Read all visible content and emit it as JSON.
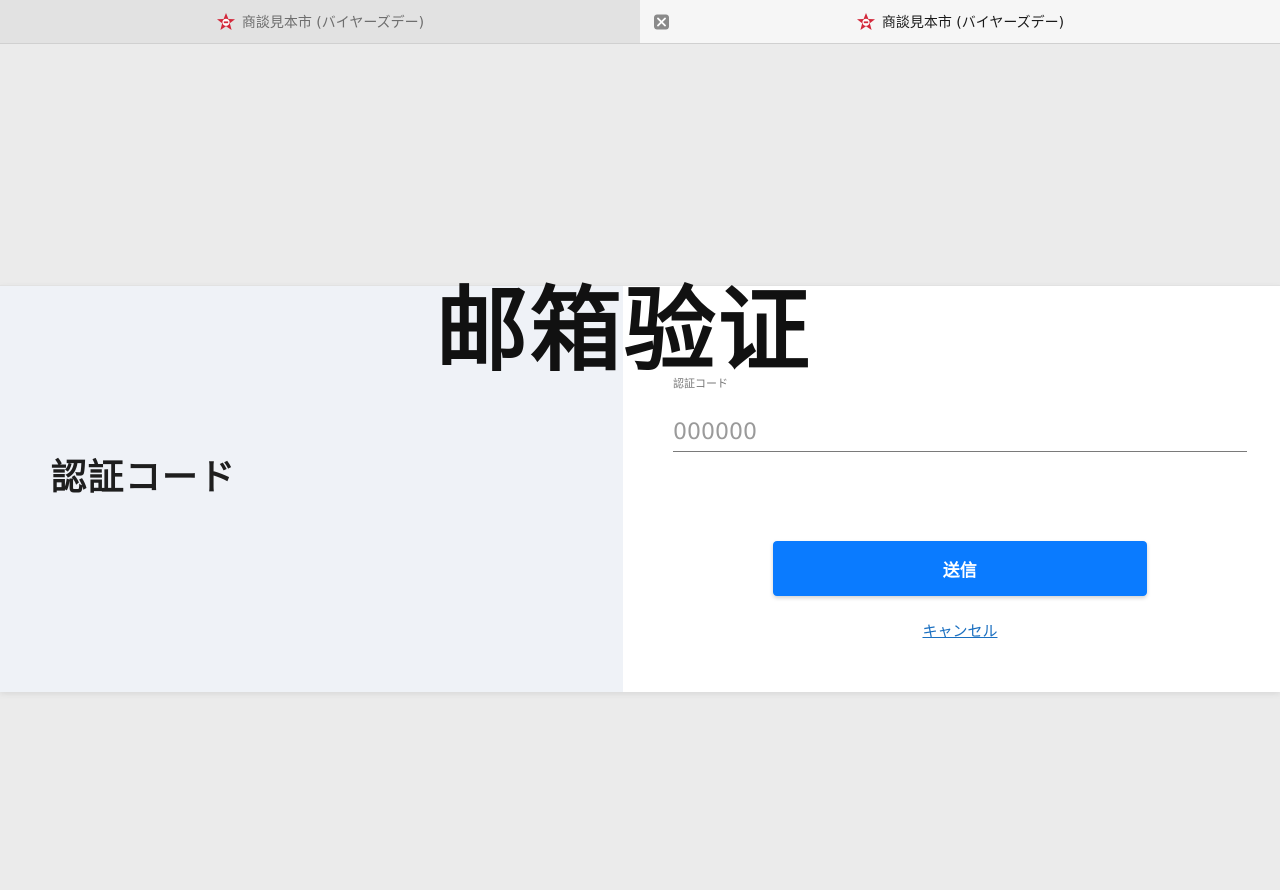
{
  "tabs": [
    {
      "title": "商談見本市 (バイヤーズデー)",
      "active": false
    },
    {
      "title": "商談見本市 (バイヤーズデー)",
      "active": true
    }
  ],
  "overlay": {
    "title": "邮箱验证"
  },
  "panel": {
    "heading": "認証コード",
    "field_label": "認証コード",
    "input_placeholder": "000000",
    "submit_label": "送信",
    "cancel_label": "キャンセル"
  },
  "colors": {
    "accent": "#0a7bff",
    "link": "#1a6fc0",
    "left_panel_bg": "#eff2f7"
  },
  "icons": {
    "favicon": "star-logo-icon",
    "close": "close-icon"
  }
}
